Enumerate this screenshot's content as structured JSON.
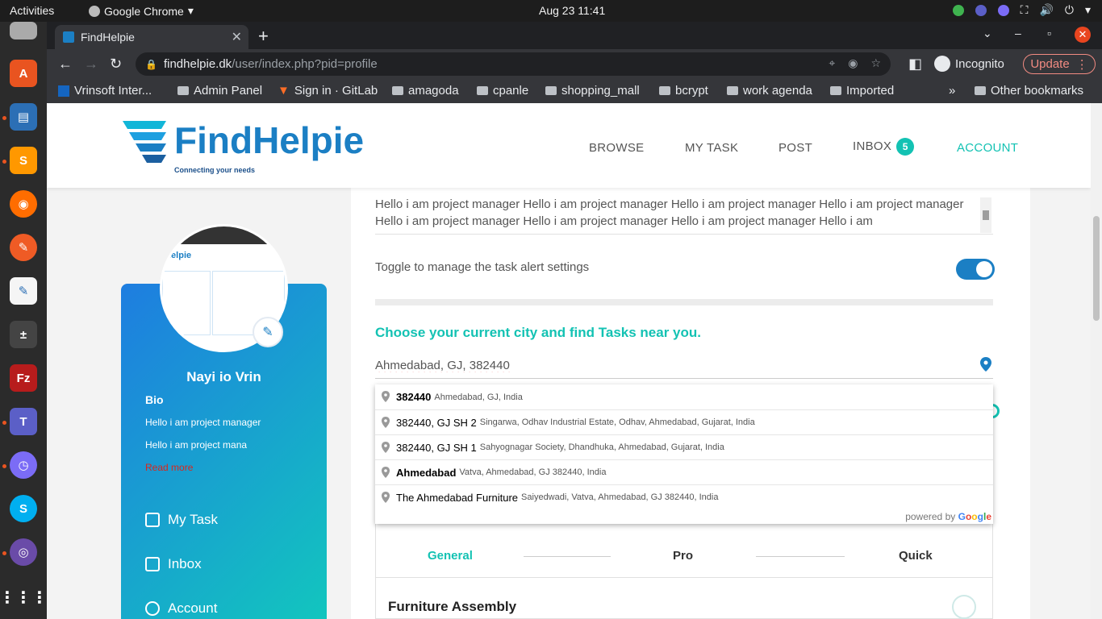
{
  "system": {
    "activities": "Activities",
    "app_name": "Google Chrome",
    "clock": "Aug 23  11:41"
  },
  "browser": {
    "tab_title": "FindHelpie",
    "url_host": "findhelpie.dk",
    "url_path": "/user/index.php?pid=profile",
    "incognito_label": "Incognito",
    "update_label": "Update",
    "bookmarks": [
      "Vrinsoft Inter...",
      "Admin Panel",
      "Sign in · GitLab",
      "amagoda",
      "cpanle",
      "shopping_mall",
      "bcrypt",
      "work agenda",
      "Imported"
    ],
    "other_bookmarks": "Other bookmarks"
  },
  "site": {
    "logo_text": "FindHelpie",
    "logo_tagline": "Connecting your needs",
    "menu": {
      "browse": "BROWSE",
      "my_task": "MY TASK",
      "post": "POST",
      "inbox": "INBOX",
      "inbox_count": "5",
      "account": "ACCOUNT"
    }
  },
  "sidebar": {
    "name": "Nayi io Vrin",
    "bio_heading": "Bio",
    "bio_line1": "Hello i am project manager",
    "bio_line2": "Hello i am project mana",
    "read_more": "Read more",
    "links": {
      "my_task": "My Task",
      "inbox": "Inbox",
      "account": "Account"
    }
  },
  "profile": {
    "bio_text": "Hello i am project manager Hello  i am project manager Hello i am project manager Hello i am project manager Hello i am project manager Hello i am project manager Hello i am project manager Hello i am",
    "toggle_label": "Toggle to manage the task alert settings",
    "toggle_on": true,
    "city_heading": "Choose your current city and find Tasks near you.",
    "city_value": "Ahmedabad, GJ, 382440"
  },
  "autocomplete": {
    "items": [
      {
        "main": "382440",
        "secondary": "Ahmedabad, GJ, India"
      },
      {
        "main": "382440, GJ SH 2",
        "secondary": "Singarwa, Odhav Industrial Estate, Odhav, Ahmedabad, Gujarat, India"
      },
      {
        "main": "382440, GJ SH 1",
        "secondary": "Sahyognagar Society, Dhandhuka, Ahmedabad, Gujarat, India"
      },
      {
        "main": "Ahmedabad",
        "secondary": "Vatva, Ahmedabad, GJ 382440, India"
      },
      {
        "main": "The Ahmedabad Furniture",
        "secondary": "Saiyedwadi, Vatva, Ahmedabad, GJ 382440, India"
      }
    ],
    "powered_by": "powered by",
    "google": "Google"
  },
  "levels": {
    "general": "General",
    "pro": "Pro",
    "quick": "Quick",
    "task_title": "Furniture Assembly"
  },
  "colors": {
    "accent_teal": "#13c2b3",
    "brand_blue": "#1b7fc4"
  }
}
